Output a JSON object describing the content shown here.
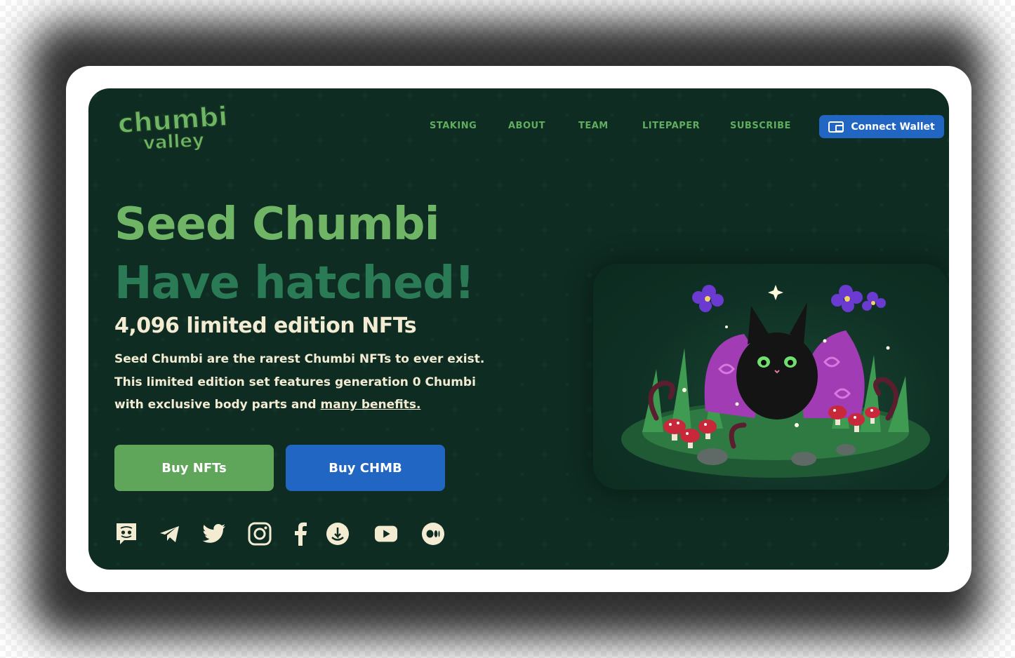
{
  "colors": {
    "page_bg": "#0e2c22",
    "accent_green": "#6fb565",
    "dark_green": "#2a7a55",
    "cream_text": "#f3ecd3",
    "nav_text": "#5fae5e",
    "button_green": "#5fa55a",
    "button_blue": "#2266c4"
  },
  "logo": {
    "line1": "chumbi",
    "line2": "valley"
  },
  "nav": {
    "items": [
      "STAKING",
      "ABOUT",
      "TEAM",
      "LITEPAPER",
      "SUBSCRIBE"
    ]
  },
  "connect_wallet": {
    "label": "Connect Wallet",
    "icon": "wallet-icon"
  },
  "hero": {
    "title_line1": "Seed Chumbi",
    "title_line2": "Have hatched!",
    "subtitle": "4,096 limited edition NFTs",
    "description_line1": "Seed Chumbi are the rarest Chumbi NFTs to ever exist.",
    "description_line2": "This limited edition set features generation 0 Chumbi",
    "description_line3_prefix": "with exclusive body parts and",
    "description_link": "many benefits."
  },
  "buttons": {
    "buy_nfts": "Buy NFTs",
    "buy_chmb": "Buy CHMB"
  },
  "socials": [
    "discord-icon",
    "telegram-icon",
    "twitter-icon",
    "instagram-icon",
    "facebook-icon",
    "coingecko-icon",
    "youtube-icon",
    "medium-icon"
  ]
}
